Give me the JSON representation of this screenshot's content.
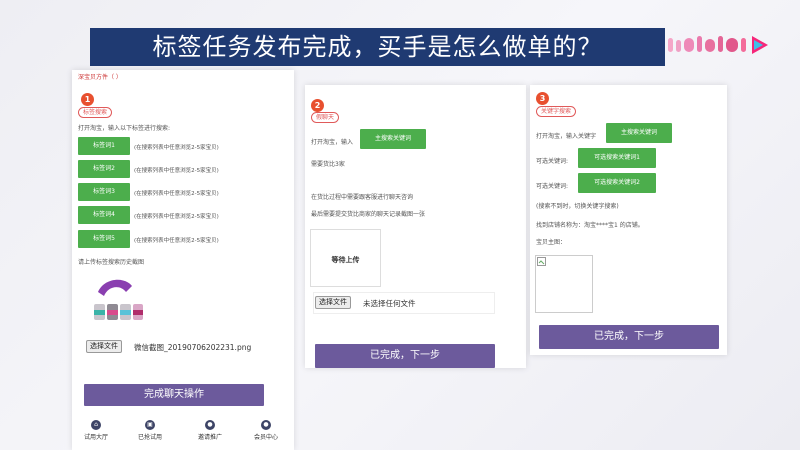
{
  "title": "标签任务发布完成，买手是怎么做单的？",
  "colors": {
    "banner": "#1f3a72",
    "green": "#4cae4c",
    "purple": "#6c5a9c",
    "badge": "#e8502f"
  },
  "panel1": {
    "top_cut_text": "深宝贝方件（ ）",
    "badge": "1",
    "pill": "标签搜索",
    "instruction": "打开淘宝，输入以下标签进行搜索:",
    "tags": [
      {
        "label": "标签词1",
        "note": "(在搜索列表中任意浏览2-5家宝贝)"
      },
      {
        "label": "标签词2",
        "note": "(在搜索列表中任意浏览2-5家宝贝)"
      },
      {
        "label": "标签词3",
        "note": "(在搜索列表中任意浏览2-5家宝贝)"
      },
      {
        "label": "标签词4",
        "note": "(在搜索列表中任意浏览2-5家宝贝)"
      },
      {
        "label": "标签词5",
        "note": "(在搜索列表中任意浏览2-5家宝贝)"
      }
    ],
    "upload_label": "请上传标签搜索历史截图",
    "file_button": "选择文件",
    "file_name": "微信截图_20190706202231.png",
    "submit": "完成聊天操作",
    "nav": [
      {
        "label": "试用大厅",
        "icon": "home-icon"
      },
      {
        "label": "已抢试用",
        "icon": "cart-icon"
      },
      {
        "label": "邀请推广",
        "icon": "user-icon"
      },
      {
        "label": "会员中心",
        "icon": "member-icon"
      }
    ]
  },
  "panel2": {
    "badge": "2",
    "pill": "假聊天",
    "instruction": "打开淘宝，输入",
    "keyword_button": "主搜索关键词",
    "line1": "需要货比3家",
    "line2": "在货比过程中需要跟客服进行聊天咨询",
    "line3": "最后需要提交货比商家的聊天记录截图一张",
    "placeholder": "等待上传",
    "file_button": "选择文件",
    "file_name": "未选择任何文件",
    "submit": "已完成，下一步"
  },
  "panel3": {
    "badge": "3",
    "pill": "关键字搜索",
    "rows": [
      {
        "label": "打开淘宝，输入关键字",
        "button": "主搜索关键词"
      },
      {
        "label": "可选关键词:",
        "button": "可选搜索关键词1"
      },
      {
        "label": "可选关键词:",
        "button": "可选搜索关键词2"
      }
    ],
    "hint": "(搜索不到时，切换关键字搜索)",
    "shop_line": "找到店铺名称为：淘宝****宝1 的店铺。",
    "main_image_label": "宝贝主图：",
    "submit": "已完成，下一步"
  }
}
